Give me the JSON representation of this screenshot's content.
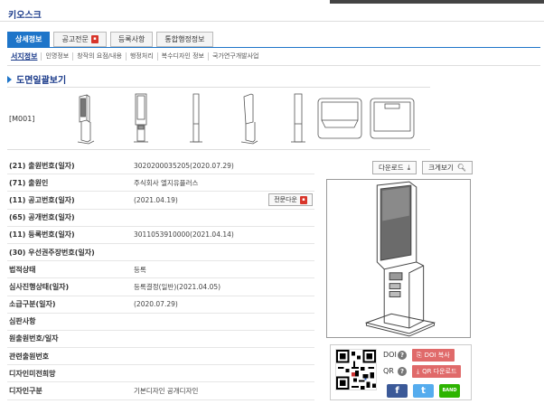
{
  "page": {
    "title": "키오스크"
  },
  "tabs": [
    {
      "label": "상세정보",
      "active": true,
      "pdf": false
    },
    {
      "label": "공고전문",
      "active": false,
      "pdf": true
    },
    {
      "label": "등록사항",
      "active": false,
      "pdf": false
    },
    {
      "label": "통합행정정보",
      "active": false,
      "pdf": false
    }
  ],
  "subtabs": [
    "서지정보",
    "인명정보",
    "창작의 요점/내용",
    "행정처리",
    "복수디자인 정보",
    "국가연구개발사업"
  ],
  "drawings": {
    "heading": "도면일괄보기",
    "code": "[M001]",
    "views": [
      "perspective-icon",
      "front-icon",
      "side-icon",
      "rear-icon",
      "side-left-icon",
      "top-icon",
      "bottom-icon"
    ]
  },
  "info": [
    {
      "label": "(21) 출원번호(일자)",
      "value": "3020200035205(2020.07.29)"
    },
    {
      "label": "(71) 출원인",
      "value": "주식회사 엘지유플러스"
    },
    {
      "label": "(11) 공고번호(일자)",
      "value": "(2021.04.19)",
      "button": "전문다운"
    },
    {
      "label": "(65) 공개번호(일자)",
      "value": ""
    },
    {
      "label": "(11) 등록번호(일자)",
      "value": "3011053910000(2021.04.14)"
    },
    {
      "label": "(30) 우선권주장번호(일자)",
      "value": ""
    },
    {
      "label": "법적상태",
      "value": "등록"
    },
    {
      "label": "심사진행상태(일자)",
      "value": "등록결정(일반)(2021.04.05)"
    },
    {
      "label": "소급구분(일자)",
      "value": "(2020.07.29)"
    },
    {
      "label": "심판사항",
      "value": ""
    },
    {
      "label": "원출원번호/일자",
      "value": ""
    },
    {
      "label": "관련출원번호",
      "value": ""
    },
    {
      "label": "디자인미전희망",
      "value": ""
    },
    {
      "label": "디자인구분",
      "value": "기본디자인 공개디자인"
    }
  ],
  "actions": {
    "download": "다운로드",
    "zoom": "크게보기"
  },
  "doi": {
    "doi_label": "DOI",
    "qr_label": "QR",
    "doi_copy": "DOI 복사",
    "qr_download": "QR 다운로드",
    "facebook": "f",
    "twitter": "t",
    "band": "BAND"
  },
  "colors": {
    "accent": "#1e75c9",
    "title": "#1a3a8a",
    "red_button": "#e06a6a",
    "facebook": "#3b5998",
    "twitter": "#55acee",
    "band": "#2db400"
  }
}
